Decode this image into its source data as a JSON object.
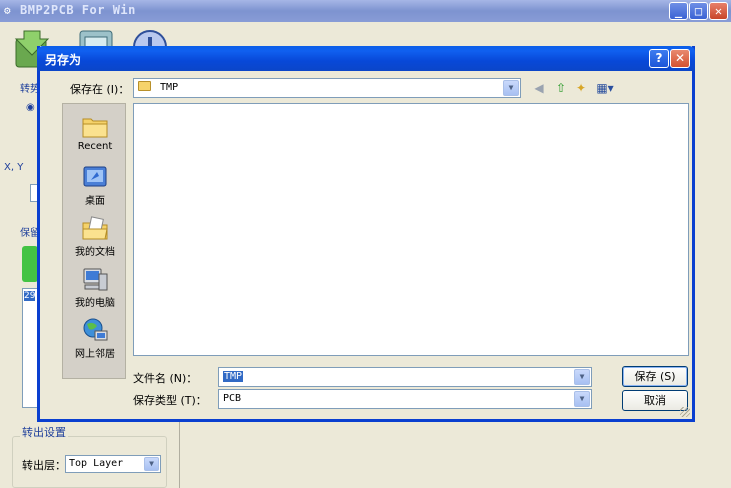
{
  "app": {
    "title": "BMP2PCB For Win",
    "controls": {
      "minimize": "_",
      "maximize": "□",
      "close": "✕"
    }
  },
  "left_panel": {
    "output_group_label": "转出设置",
    "layer_label": "转出层：",
    "layer_value": "Top  Layer",
    "behind_fragments": [
      "转势",
      "X, Y",
      "保留",
      "29"
    ]
  },
  "dialog": {
    "title": "另存为",
    "help": "?",
    "close": "✕",
    "save_in_label": "保存在 (I)：",
    "current_folder": "TMP",
    "places": [
      {
        "label": "Recent",
        "icon": "recent-folder-icon"
      },
      {
        "label": "桌面",
        "icon": "desktop-icon"
      },
      {
        "label": "我的文档",
        "icon": "my-documents-icon"
      },
      {
        "label": "我的电脑",
        "icon": "my-computer-icon"
      },
      {
        "label": "网上邻居",
        "icon": "network-places-icon"
      }
    ],
    "filename_label": "文件名 (N)：",
    "filename_value": "TMP",
    "filetype_label": "保存类型 (T)：",
    "filetype_value": "PCB",
    "save_button": "保存 (S)",
    "cancel_button": "取消"
  },
  "colors": {
    "dialog_title": "#0a52e0",
    "app_title_inactive": "#8a9ed8",
    "window_bg": "#ece9d8",
    "selection": "#316ac5"
  }
}
